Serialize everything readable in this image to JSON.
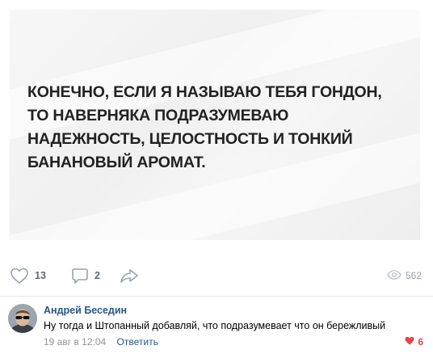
{
  "post": {
    "image_text_lines": [
      "КОНЕЧНО, ЕСЛИ Я НАЗЫВАЮ ТЕБЯ ГОНДОН,",
      "ТО НАВЕРНЯКА ПОДРАЗУМЕВАЮ",
      "НАДЕЖНОСТЬ, ЦЕЛОСТНОСТЬ И ТОНКИЙ",
      "БАНАНОВЫЙ АРОМАТ."
    ],
    "likes_count": "13",
    "comments_count": "2",
    "views_count": "562"
  },
  "comment": {
    "author": "Андрей Беседин",
    "text": "Ну тогда и Штопанный добавляй, что подразумевает что он бережливый",
    "date": "19 авг в 12:04",
    "reply_label": "Ответить",
    "likes_count": "6"
  },
  "icons": {
    "like": "heart-outline-icon",
    "comment": "speech-bubble-icon",
    "share": "share-arrow-icon",
    "views": "eye-icon",
    "comment_like": "heart-filled-icon"
  },
  "colors": {
    "link": "#2a5885",
    "muted": "#828282",
    "like_active": "#e64646",
    "divider": "#e7e8ec"
  }
}
